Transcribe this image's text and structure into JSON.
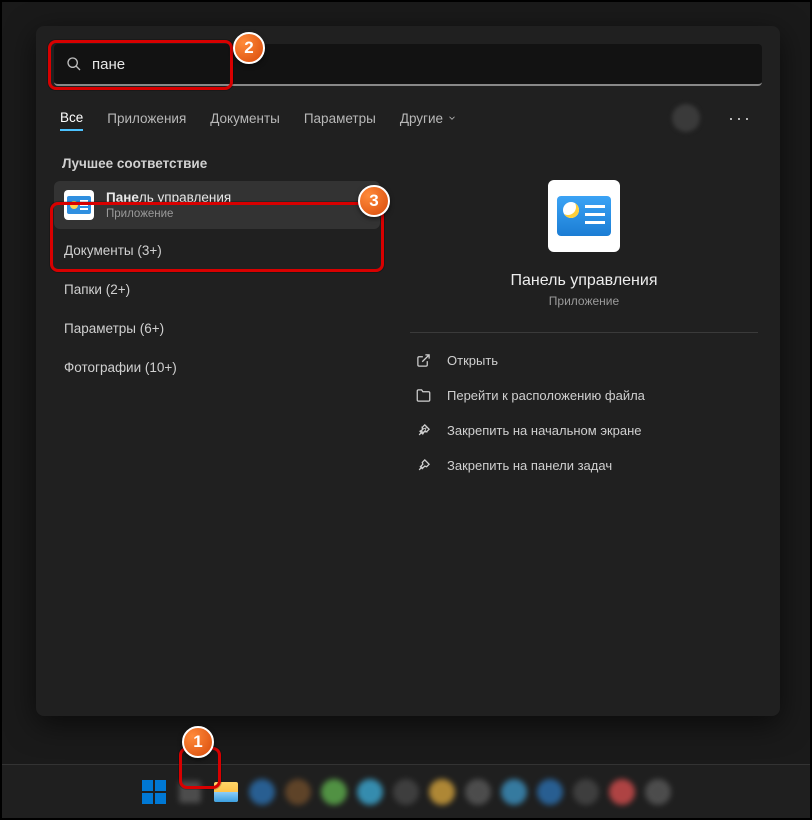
{
  "search": {
    "query": "пане"
  },
  "tabs": {
    "all": "Все",
    "apps": "Приложения",
    "docs": "Документы",
    "settings": "Параметры",
    "more": "Другие"
  },
  "left": {
    "best_match": "Лучшее соответствие",
    "result": {
      "title_bold": "Пане",
      "title_rest": "ль управления",
      "subtitle": "Приложение"
    },
    "categories": {
      "documents": "Документы (3+)",
      "folders": "Папки (2+)",
      "parameters": "Параметры (6+)",
      "photos": "Фотографии (10+)"
    }
  },
  "preview": {
    "title": "Панель управления",
    "subtitle": "Приложение"
  },
  "actions": {
    "open": "Открыть",
    "goto": "Перейти к расположению файла",
    "pinStart": "Закрепить на начальном экране",
    "pinTaskbar": "Закрепить на панели задач"
  },
  "badges": {
    "b1": "1",
    "b2": "2",
    "b3": "3"
  }
}
